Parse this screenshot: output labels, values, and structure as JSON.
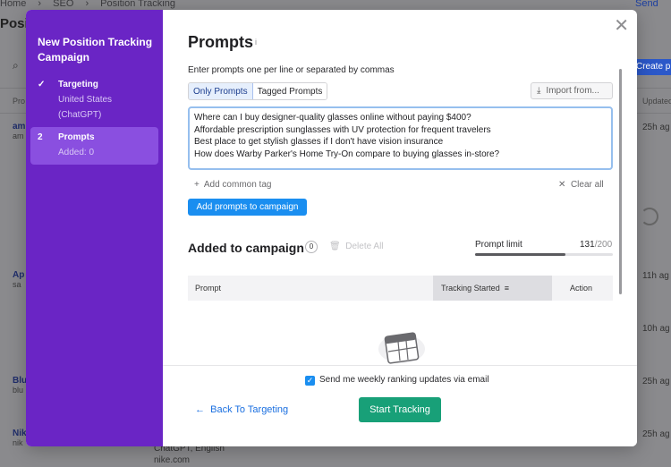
{
  "background": {
    "breadcrumbs": [
      "Home",
      "›",
      "SEO",
      "›",
      "Position Tracking"
    ],
    "page_title": "Posi",
    "send_label": "Send",
    "create_label": "Create pr",
    "prompt_col": "Pro",
    "updated_col": "Updated",
    "rows": [
      {
        "name": "am",
        "sub": "am"
      },
      {
        "name": "Ap",
        "sub": "sa"
      },
      {
        "name": "Blu",
        "sub": "blu"
      },
      {
        "name": "Nik",
        "sub": "nik"
      }
    ],
    "updated_values": [
      "25h ag",
      "11h ag",
      "10h ag",
      "25h ag",
      "25h ag"
    ],
    "bottom_lines": [
      "ChatGPT, English",
      "nike.com"
    ]
  },
  "sidebar": {
    "title": "New Position Tracking Campaign",
    "steps": [
      {
        "mark": "✓",
        "title": "Targeting",
        "sub1": "United States",
        "sub2": "(ChatGPT)"
      },
      {
        "mark": "2",
        "title": "Prompts",
        "sub1": "Added: 0"
      }
    ]
  },
  "main": {
    "title": "Prompts",
    "info_icon": "i",
    "hint": "Enter prompts one per line or separated by commas",
    "tabs": [
      "Only Prompts",
      "Tagged Prompts"
    ],
    "import_label": "Import from...",
    "prompts": [
      "Where can I buy designer-quality glasses online without paying $400?",
      "Affordable prescription sunglasses with UV protection for frequent travelers",
      "Best place to get stylish glasses if I don't have vision insurance",
      "How does Warby Parker's Home Try-On compare to buying glasses in-store?"
    ],
    "add_tag_label": "Add common tag",
    "clear_all_label": "Clear all",
    "add_button_label": "Add prompts to campaign",
    "added_title": "Added to campaign",
    "added_count": "0",
    "delete_all_label": "Delete All",
    "limit_label": "Prompt limit",
    "limit_used": "131",
    "limit_max": "/200",
    "limit_fraction": 0.655,
    "table_headers": {
      "prompt": "Prompt",
      "tracking": "Tracking Started",
      "action": "Action"
    }
  },
  "footer": {
    "checkbox_label": "Send me weekly ranking updates via email",
    "checkbox_checked": true,
    "back_label": "Back To Targeting",
    "start_label": "Start Tracking"
  },
  "colors": {
    "sidebar": "#6a25c5",
    "sidebar_active": "#8a4fe0",
    "primary_blue": "#1a8ef0",
    "start_green": "#18a078"
  }
}
